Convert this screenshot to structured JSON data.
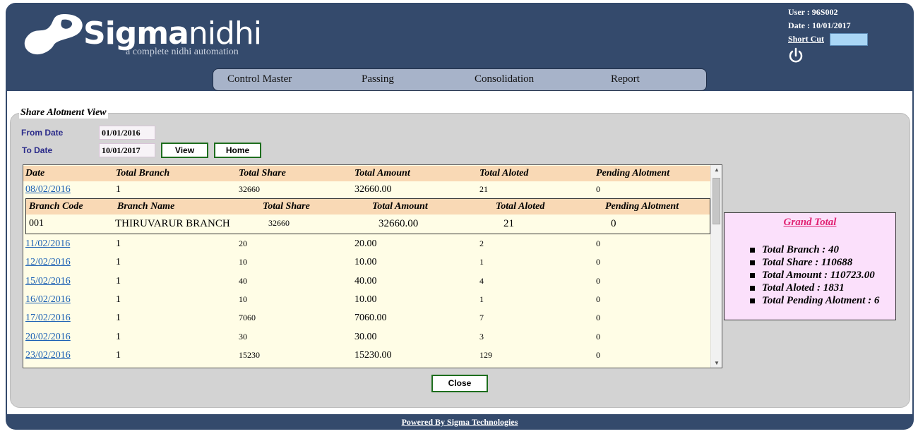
{
  "header": {
    "logo_bold": "Sigma",
    "logo_light": "nidhi",
    "tagline": "a complete nidhi automation",
    "user": "User : 96S002",
    "date": "Date : 10/01/2017",
    "shortcut_label": "Short Cut"
  },
  "nav": [
    "Control Master",
    "Passing",
    "Consolidation",
    "Report"
  ],
  "form": {
    "legend": "Share Alotment View",
    "from_label": "From Date",
    "from_value": "01/01/2016",
    "to_label": "To Date",
    "to_value": "10/01/2017",
    "view_label": "View",
    "home_label": "Home"
  },
  "grid": {
    "headers": [
      "Date",
      "Total Branch",
      "Total Share",
      "Total Amount",
      "Total Aloted",
      "Pending Alotment"
    ],
    "first_row": [
      "08/02/2016",
      "1",
      "32660",
      "32660.00",
      "21",
      "0"
    ],
    "sub_headers": [
      "Branch Code",
      "Branch Name",
      "Total Share",
      "Total Amount",
      "Total Aloted",
      "Pending Alotment"
    ],
    "sub_row": [
      "001",
      "THIRUVARUR BRANCH",
      "32660",
      "32660.00",
      "21",
      "0"
    ],
    "rows": [
      [
        "11/02/2016",
        "1",
        "20",
        "20.00",
        "2",
        "0"
      ],
      [
        "12/02/2016",
        "1",
        "10",
        "10.00",
        "1",
        "0"
      ],
      [
        "15/02/2016",
        "1",
        "40",
        "40.00",
        "4",
        "0"
      ],
      [
        "16/02/2016",
        "1",
        "10",
        "10.00",
        "1",
        "0"
      ],
      [
        "17/02/2016",
        "1",
        "7060",
        "7060.00",
        "7",
        "0"
      ],
      [
        "20/02/2016",
        "1",
        "30",
        "30.00",
        "3",
        "0"
      ],
      [
        "23/02/2016",
        "1",
        "15230",
        "15230.00",
        "129",
        "0"
      ]
    ]
  },
  "grand_total": {
    "title": "Grand Total",
    "items": [
      "Total Branch : 40",
      "Total Share : 110688",
      "Total Amount : 110723.00",
      "Total Aloted : 1831",
      "Total Pending Alotment : 6"
    ]
  },
  "close_label": "Close",
  "footer": "Powered By Sigma Technologies"
}
